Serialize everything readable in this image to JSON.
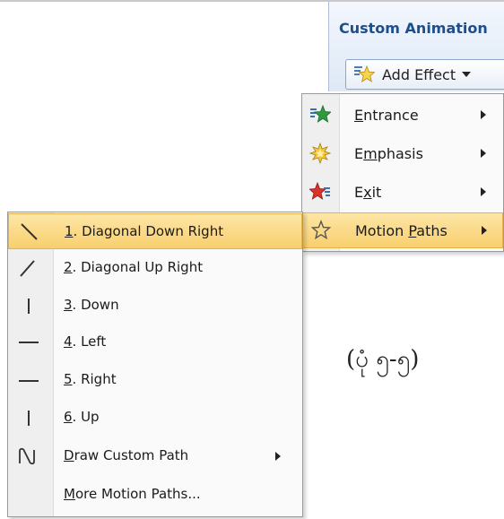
{
  "pane": {
    "title": "Custom Animation",
    "add_effect": {
      "label": "Add Effect",
      "icon": "add-effect-star-icon"
    }
  },
  "effect_menu": {
    "items": [
      {
        "key": "E",
        "rest": "ntrance",
        "icon": "entrance-star-icon",
        "submenu": true
      },
      {
        "pre": "E",
        "key": "m",
        "rest": "phasis",
        "icon": "emphasis-star-icon",
        "submenu": true
      },
      {
        "pre": "E",
        "key": "x",
        "rest": "it",
        "icon": "exit-star-icon",
        "submenu": true
      },
      {
        "pre": "Motion ",
        "key": "P",
        "rest": "aths",
        "icon": "motion-paths-star-icon",
        "submenu": true,
        "highlighted": true
      }
    ]
  },
  "motion_paths_menu": {
    "items": [
      {
        "key": "1",
        "rest": ". Diagonal Down Right",
        "icon": "diagonal-down-right-icon",
        "highlighted": true
      },
      {
        "key": "2",
        "rest": ". Diagonal Up Right",
        "icon": "diagonal-up-right-icon"
      },
      {
        "key": "3",
        "rest": ". Down",
        "icon": "down-line-icon"
      },
      {
        "key": "4",
        "rest": ". Left",
        "icon": "left-line-icon"
      },
      {
        "key": "5",
        "rest": ". Right",
        "icon": "right-line-icon"
      },
      {
        "key": "6",
        "rest": ". Up",
        "icon": "up-line-icon"
      },
      {
        "key": "D",
        "rest": "raw Custom Path",
        "icon": "custom-path-icon",
        "submenu": true
      },
      {
        "key": "M",
        "rest": "ore Motion Paths...",
        "icon": ""
      }
    ]
  },
  "caption": "(ပုံ ၅-၅)",
  "colors": {
    "highlight": "#f8cf6e",
    "title": "#1f4e8c"
  }
}
